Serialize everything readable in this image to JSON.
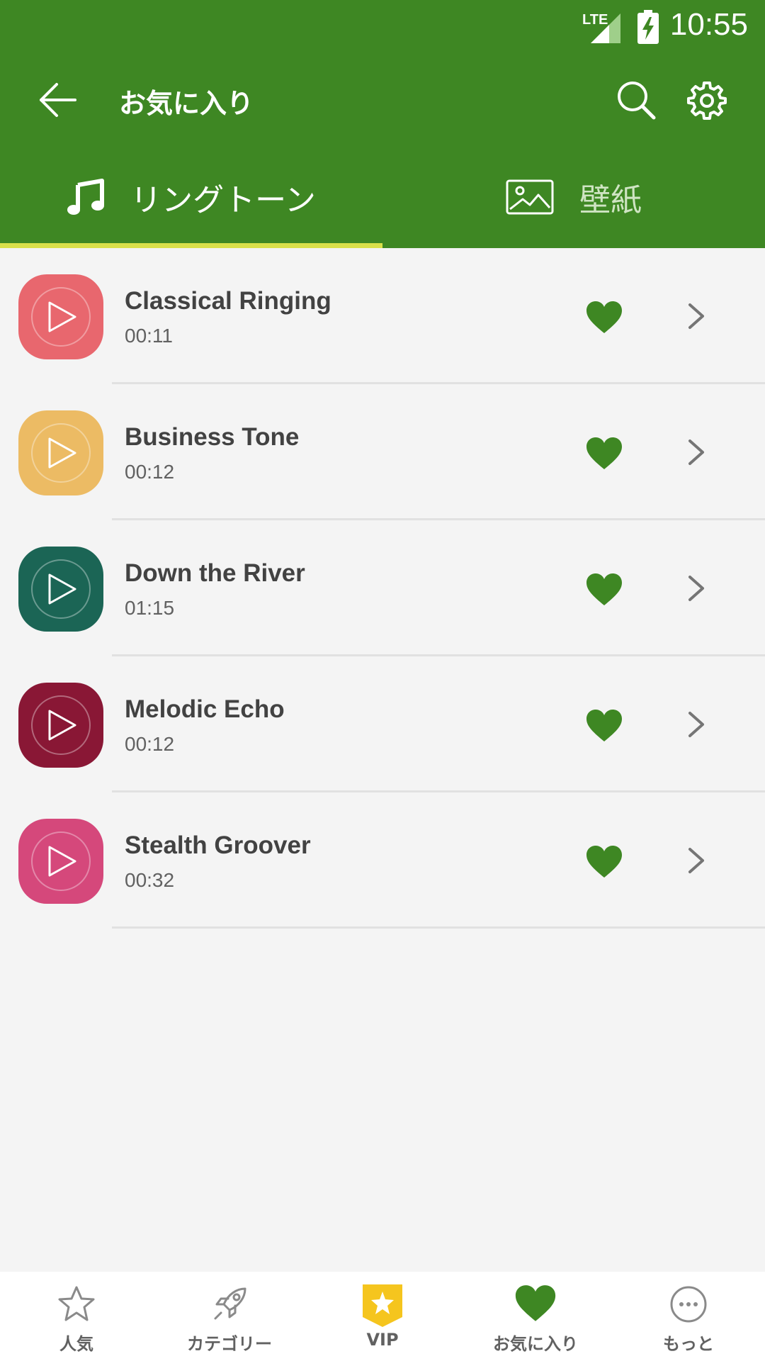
{
  "status_bar": {
    "time": "10:55",
    "network": "LTE"
  },
  "toolbar": {
    "title": "お気に入り"
  },
  "tabs": [
    {
      "label": "リングトーン",
      "icon": "music-note-icon",
      "active": true
    },
    {
      "label": "壁紙",
      "icon": "image-icon",
      "active": false
    }
  ],
  "colors": {
    "primary": "#3e8723",
    "indicator": "#d9e04a",
    "heart": "#3e8723"
  },
  "songs": [
    {
      "title": "Classical Ringing",
      "duration": "00:11",
      "color": "#e8676e",
      "favorite": true
    },
    {
      "title": "Business Tone",
      "duration": "00:12",
      "color": "#ecbb64",
      "favorite": true
    },
    {
      "title": "Down the River",
      "duration": "01:15",
      "color": "#1b6555",
      "favorite": true
    },
    {
      "title": "Melodic Echo",
      "duration": "00:12",
      "color": "#891735",
      "favorite": true
    },
    {
      "title": "Stealth Groover",
      "duration": "00:32",
      "color": "#d5487b",
      "favorite": true
    }
  ],
  "bottom_nav": [
    {
      "label": "人気",
      "icon": "star-icon"
    },
    {
      "label": "カテゴリー",
      "icon": "rocket-icon"
    },
    {
      "label": "VIP",
      "icon": "vip-badge-icon"
    },
    {
      "label": "お気に入り",
      "icon": "heart-icon",
      "active": true
    },
    {
      "label": "もっと",
      "icon": "more-icon"
    }
  ]
}
